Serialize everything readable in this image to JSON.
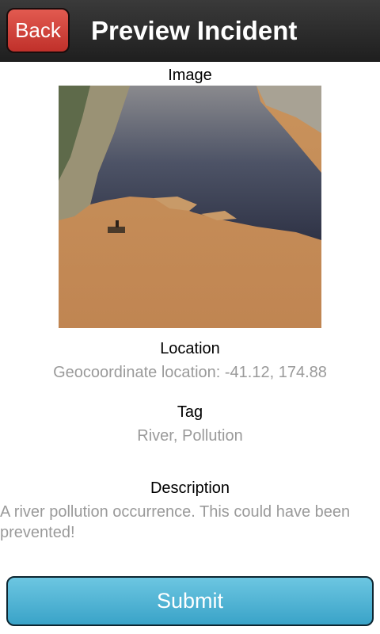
{
  "header": {
    "back_label": "Back",
    "title": "Preview Incident"
  },
  "image_section": {
    "label": "Image",
    "photo_icon": "river-pollution-photo"
  },
  "location_section": {
    "label": "Location",
    "value": "Geocoordinate location: -41.12, 174.88"
  },
  "tag_section": {
    "label": "Tag",
    "value": "River, Pollution"
  },
  "description_section": {
    "label": "Description",
    "value": "A river pollution occurrence. This could have been prevented!"
  },
  "submit": {
    "label": "Submit"
  },
  "colors": {
    "header_bg": "#2a2a2a",
    "back_button": "#d2443c",
    "submit_button": "#4fb3d6",
    "muted_text": "#9a9a9a"
  }
}
